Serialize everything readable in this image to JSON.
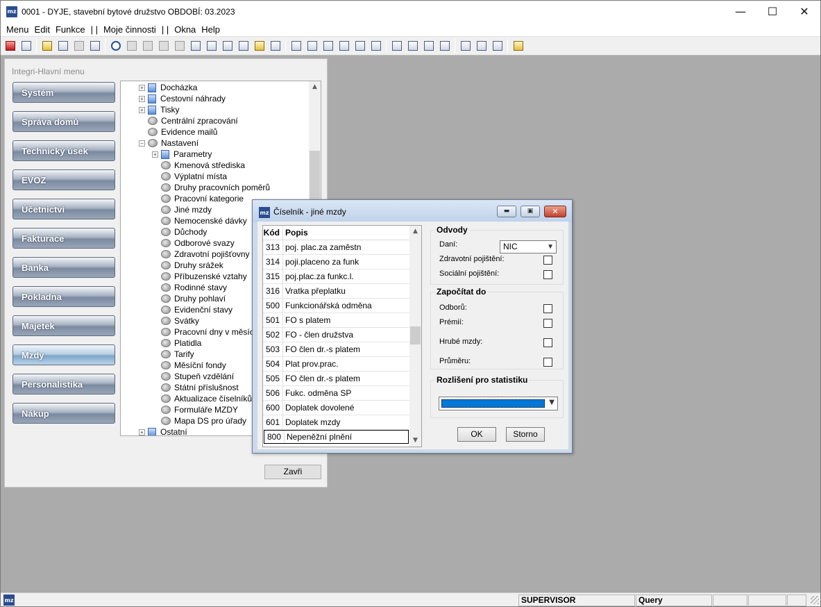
{
  "window": {
    "title": "0001 - DYJE, stavební bytové družstvo OBDOBÍ: 03.2023",
    "icon_label": "mz",
    "controls": {
      "minimize": "—",
      "maximize": "☐",
      "close": "✕"
    }
  },
  "menubar": {
    "items": [
      "Menu",
      "Edit",
      "Funkce",
      "| |",
      "Moje činnosti",
      "| |",
      "Okna",
      "Help"
    ]
  },
  "main_menu": {
    "title": "Integri-Hlavní menu",
    "nav": [
      "Systém",
      "Správa domů",
      "Technický úsek",
      "EVOZ",
      "Účetnictví",
      "Fakturace",
      "Banka",
      "Pokladna",
      "Majetek",
      "Mzdy",
      "Personalistika",
      "Nákup"
    ],
    "active_nav": "Mzdy",
    "tree": [
      {
        "label": "Docházka",
        "level": 0,
        "kind": "folder",
        "expander": "+"
      },
      {
        "label": "Cestovní náhrady",
        "level": 0,
        "kind": "folder",
        "expander": "+"
      },
      {
        "label": "Tisky",
        "level": 0,
        "kind": "folder",
        "expander": "+"
      },
      {
        "label": "Centrální zpracování",
        "level": 0,
        "kind": "gear",
        "expander": ""
      },
      {
        "label": "Evidence mailů",
        "level": 0,
        "kind": "gear",
        "expander": ""
      },
      {
        "label": "Nastavení",
        "level": 0,
        "kind": "gear",
        "expander": "−"
      },
      {
        "label": "Parametry",
        "level": 1,
        "kind": "folder",
        "expander": "+"
      },
      {
        "label": "Kmenová střediska",
        "level": 1,
        "kind": "gear",
        "expander": ""
      },
      {
        "label": "Výplatní místa",
        "level": 1,
        "kind": "gear",
        "expander": ""
      },
      {
        "label": "Druhy pracovních poměrů",
        "level": 1,
        "kind": "gear",
        "expander": ""
      },
      {
        "label": "Pracovní kategorie",
        "level": 1,
        "kind": "gear",
        "expander": ""
      },
      {
        "label": "Jiné mzdy",
        "level": 1,
        "kind": "gear",
        "expander": ""
      },
      {
        "label": "Nemocenské dávky",
        "level": 1,
        "kind": "gear",
        "expander": ""
      },
      {
        "label": "Důchody",
        "level": 1,
        "kind": "gear",
        "expander": ""
      },
      {
        "label": "Odborové svazy",
        "level": 1,
        "kind": "gear",
        "expander": ""
      },
      {
        "label": "Zdravotní pojišťovny",
        "level": 1,
        "kind": "gear",
        "expander": ""
      },
      {
        "label": "Druhy srážek",
        "level": 1,
        "kind": "gear",
        "expander": ""
      },
      {
        "label": "Příbuzenské vztahy",
        "level": 1,
        "kind": "gear",
        "expander": ""
      },
      {
        "label": "Rodinné stavy",
        "level": 1,
        "kind": "gear",
        "expander": ""
      },
      {
        "label": "Druhy pohlaví",
        "level": 1,
        "kind": "gear",
        "expander": ""
      },
      {
        "label": "Evidenční stavy",
        "level": 1,
        "kind": "gear",
        "expander": ""
      },
      {
        "label": "Svátky",
        "level": 1,
        "kind": "gear",
        "expander": ""
      },
      {
        "label": "Pracovní dny v měsíci",
        "level": 1,
        "kind": "gear",
        "expander": ""
      },
      {
        "label": "Platidla",
        "level": 1,
        "kind": "gear",
        "expander": ""
      },
      {
        "label": "Tarify",
        "level": 1,
        "kind": "gear",
        "expander": ""
      },
      {
        "label": "Měsíční fondy",
        "level": 1,
        "kind": "gear",
        "expander": ""
      },
      {
        "label": "Stupeň vzdělání",
        "level": 1,
        "kind": "gear",
        "expander": ""
      },
      {
        "label": "Státní příslušnost",
        "level": 1,
        "kind": "gear",
        "expander": ""
      },
      {
        "label": "Aktualizace číselníků",
        "level": 1,
        "kind": "gear",
        "expander": ""
      },
      {
        "label": "Formuláře MZDY",
        "level": 1,
        "kind": "gear",
        "expander": ""
      },
      {
        "label": "Mapa DS pro úřady",
        "level": 1,
        "kind": "gear",
        "expander": ""
      },
      {
        "label": "Ostatní",
        "level": 0,
        "kind": "folder",
        "expander": "+"
      }
    ],
    "close_button": "Zavři"
  },
  "dialog": {
    "title": "Číselník - jiné mzdy",
    "icon_label": "mz",
    "columns": {
      "code": "Kód",
      "desc": "Popis"
    },
    "rows": [
      {
        "code": "313",
        "desc": "poj. plac.za zaměstn"
      },
      {
        "code": "314",
        "desc": "poji.placeno za funk"
      },
      {
        "code": "315",
        "desc": "poj.plac.za funkc.l."
      },
      {
        "code": "316",
        "desc": "Vratka přeplatku"
      },
      {
        "code": "500",
        "desc": "Funkcionářská odměna"
      },
      {
        "code": "501",
        "desc": "FO s platem"
      },
      {
        "code": "502",
        "desc": "FO - člen družstva"
      },
      {
        "code": "503",
        "desc": "FO člen dr.-s platem"
      },
      {
        "code": "504",
        "desc": "Plat prov.prac."
      },
      {
        "code": "505",
        "desc": "FO člen dr.-s platem"
      },
      {
        "code": "506",
        "desc": "Fukc. odměna SP"
      },
      {
        "code": "600",
        "desc": "Doplatek dovolené"
      },
      {
        "code": "601",
        "desc": "Doplatek mzdy"
      },
      {
        "code": "800",
        "desc": "Nepeněžní plnění"
      }
    ],
    "selected_code": "800",
    "odvody": {
      "title": "Odvody",
      "dan_label": "Daní:",
      "dan_value": "NIC",
      "zdrav_label": "Zdravotní pojištění:",
      "soc_label": "Sociální pojištění:"
    },
    "zapocitat": {
      "title": "Započítat do",
      "odboru": "Odborů:",
      "premii": "Prémií:",
      "hrube": "Hrubé mzdy:",
      "prumeru": "Průměru:"
    },
    "statistika": {
      "title": "Rozlišení pro statistiku"
    },
    "ok": "OK",
    "storno": "Storno"
  },
  "statusbar": {
    "icon_label": "mz",
    "user": "SUPERVISOR",
    "mode": "Query"
  }
}
